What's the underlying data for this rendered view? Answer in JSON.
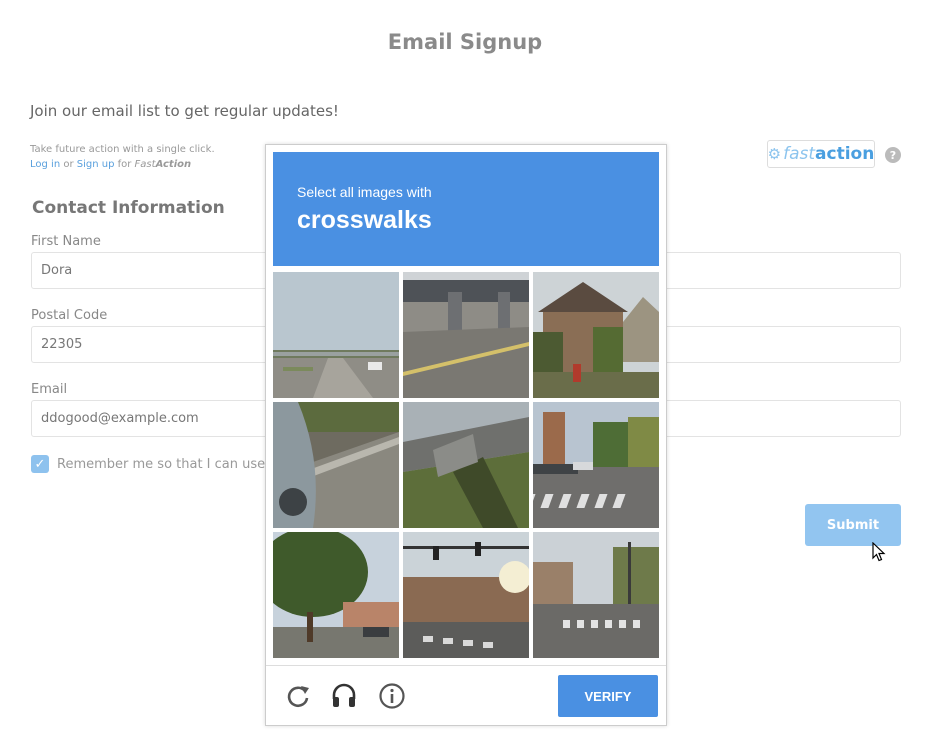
{
  "page": {
    "title": "Email Signup",
    "intro": "Join our email list to get regular updates!"
  },
  "fastaction": {
    "note": "Take future action with a single click.",
    "login": "Log in",
    "or": " or ",
    "signup": "Sign up",
    "for": " for ",
    "brand_fast": "Fast",
    "brand_action": "Action",
    "logo_fast": "fast",
    "logo_action": "action",
    "help": "?"
  },
  "contact": {
    "title": "Contact Information",
    "fields": [
      {
        "label": "First Name",
        "value": "Dora"
      },
      {
        "label": "Postal Code",
        "value": "22305"
      },
      {
        "label": "Email",
        "value": "ddogood@example.com"
      }
    ],
    "remember": "Remember me so that I can use Fa"
  },
  "submit_label": "Submit",
  "captcha": {
    "instruction": "Select all images with",
    "target": "crosswalks",
    "verify_label": "VERIFY",
    "tiles": [
      "highway-overpass",
      "under-bridge-road",
      "house-with-tree",
      "car-curb-closeup",
      "bridge-underside",
      "intersection-crosswalk",
      "trees-parking-lot",
      "traffic-light-crosswalk",
      "street-crosswalk"
    ]
  },
  "colors": {
    "accent": "#4a90e2",
    "submit": "#92c5f0",
    "link": "#5aa0dd"
  }
}
